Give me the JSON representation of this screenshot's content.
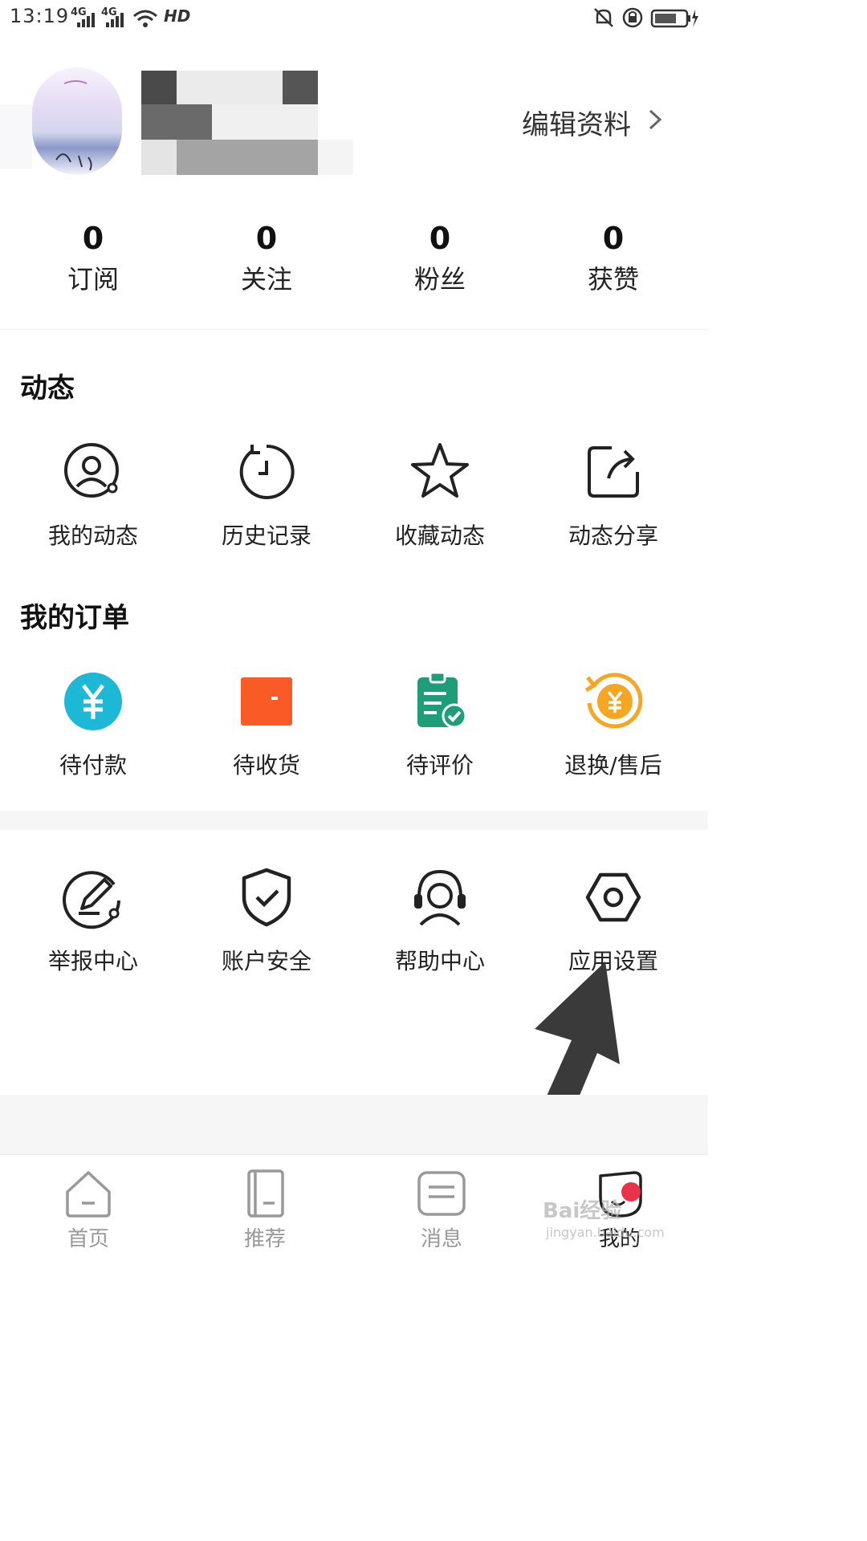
{
  "status_bar": {
    "time": "13:19",
    "signal_1": "4G",
    "signal_2": "4G",
    "hd": "HD"
  },
  "profile": {
    "edit_label": "编辑资料"
  },
  "stats": [
    {
      "value": "0",
      "label": "订阅"
    },
    {
      "value": "0",
      "label": "关注"
    },
    {
      "value": "0",
      "label": "粉丝"
    },
    {
      "value": "0",
      "label": "获赞"
    }
  ],
  "activity": {
    "title": "动态",
    "items": [
      {
        "label": "我的动态",
        "icon": "user-circle-icon"
      },
      {
        "label": "历史记录",
        "icon": "history-clock-icon"
      },
      {
        "label": "收藏动态",
        "icon": "star-icon"
      },
      {
        "label": "动态分享",
        "icon": "share-icon"
      }
    ]
  },
  "orders": {
    "title": "我的订单",
    "items": [
      {
        "label": "待付款",
        "icon": "yuan-coin-icon",
        "color": "#1cb8d6"
      },
      {
        "label": "待收货",
        "icon": "wallet-icon",
        "color": "#fa5a26"
      },
      {
        "label": "待评价",
        "icon": "clipboard-check-icon",
        "color": "#1e9e78"
      },
      {
        "label": "退换/售后",
        "icon": "refund-icon",
        "color": "#f6a623"
      }
    ]
  },
  "services": {
    "items": [
      {
        "label": "举报中心",
        "icon": "report-pen-icon"
      },
      {
        "label": "账户安全",
        "icon": "shield-check-icon"
      },
      {
        "label": "帮助中心",
        "icon": "headset-icon"
      },
      {
        "label": "应用设置",
        "icon": "settings-hexagon-icon"
      }
    ]
  },
  "bottom_nav": {
    "items": [
      {
        "label": "首页",
        "icon": "home-icon",
        "active": false
      },
      {
        "label": "推荐",
        "icon": "book-icon",
        "active": false
      },
      {
        "label": "消息",
        "icon": "message-icon",
        "active": false
      },
      {
        "label": "我的",
        "icon": "profile-icon",
        "active": true
      }
    ]
  },
  "watermark": {
    "text": "Bai经验",
    "sub": "jingyan.baidu.com"
  },
  "colors": {
    "accent": "#e8334a",
    "text": "#222222",
    "muted": "#999999"
  }
}
